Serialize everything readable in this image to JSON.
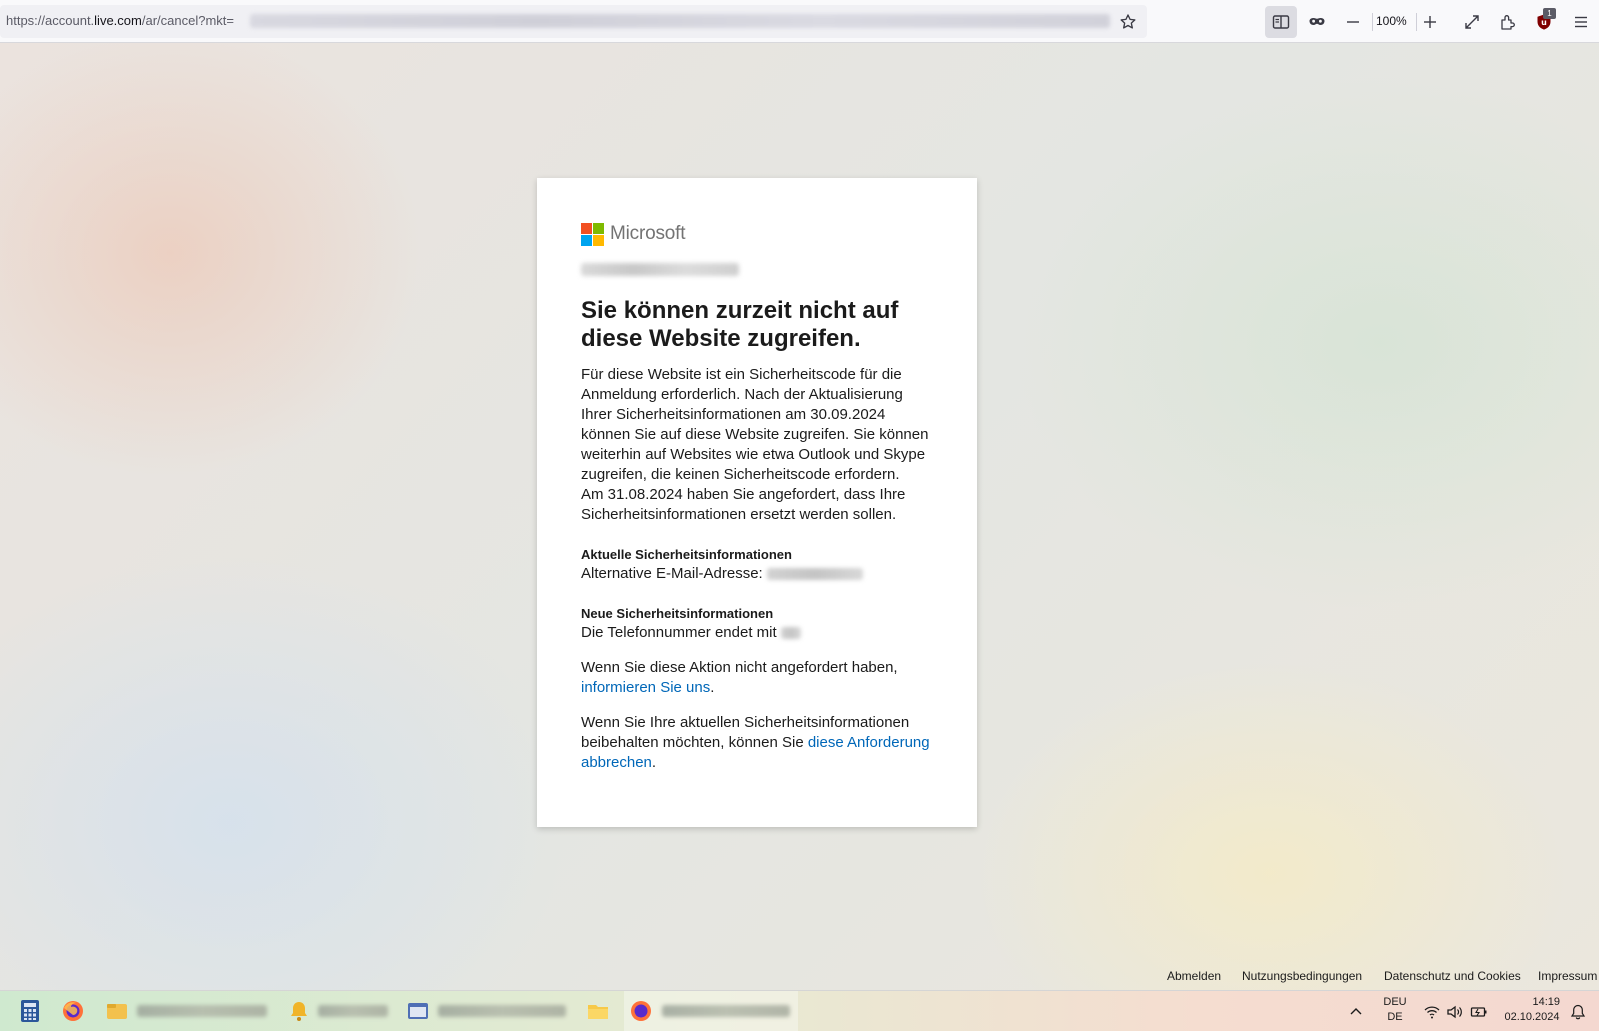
{
  "browser": {
    "url_prefix": "https://account.",
    "url_domain": "live.com",
    "url_path": "/ar/cancel?mkt=",
    "zoom_level": "100%",
    "ublock_count": "1"
  },
  "card": {
    "brand": "Microsoft",
    "title": "Sie können zurzeit nicht auf diese Website zugreifen.",
    "intro_1": "Für diese Website ist ein Sicherheitscode für die Anmeldung erforderlich. Nach der Aktualisierung Ihrer Sicherheitsinformationen am 30.09.2024 können Sie auf diese Website zugreifen. Sie können weiterhin auf Websites wie etwa Outlook und Skype zugreifen, die keinen Sicherheitscode erfordern.",
    "intro_2": "Am 31.08.2024 haben Sie angefordert, dass Ihre Sicherheitsinformationen ersetzt werden sollen.",
    "current_heading": "Aktuelle Sicherheitsinformationen",
    "current_label": "Alternative E-Mail-Adresse: ",
    "new_heading": "Neue Sicherheitsinformationen",
    "new_label": "Die Telefonnummer endet mit ",
    "para_report_text": "Wenn Sie diese Aktion nicht angefordert haben, ",
    "para_report_link": "informieren Sie uns",
    "para_report_end": ".",
    "para_keep_text": "Wenn Sie Ihre aktuellen Sicherheitsinformationen beibehalten möchten, können Sie ",
    "para_keep_link": "diese Anforderung abbrechen",
    "para_keep_end": "."
  },
  "footer": {
    "signout": "Abmelden",
    "terms": "Nutzungsbedingungen",
    "privacy": "Datenschutz und Cookies",
    "imprint": "Impressum"
  },
  "taskbar": {
    "lang_top": "DEU",
    "lang_bottom": "DE",
    "time": "14:19",
    "date": "02.10.2024"
  },
  "colors": {
    "link": "#0067b8",
    "ms_red": "#f25022",
    "ms_green": "#7fba00",
    "ms_blue": "#00a4ef",
    "ms_yellow": "#ffb900"
  },
  "icons": [
    "star-icon",
    "reader-view-icon",
    "private-mask-icon",
    "zoom-out-icon",
    "zoom-in-icon",
    "fullscreen-icon",
    "extensions-icon",
    "ublock-icon",
    "menu-icon",
    "calculator-icon",
    "firefox-icon",
    "folder-icon",
    "bell-icon",
    "wifi-icon",
    "volume-icon",
    "battery-icon",
    "chevron-up-icon",
    "notification-icon"
  ]
}
